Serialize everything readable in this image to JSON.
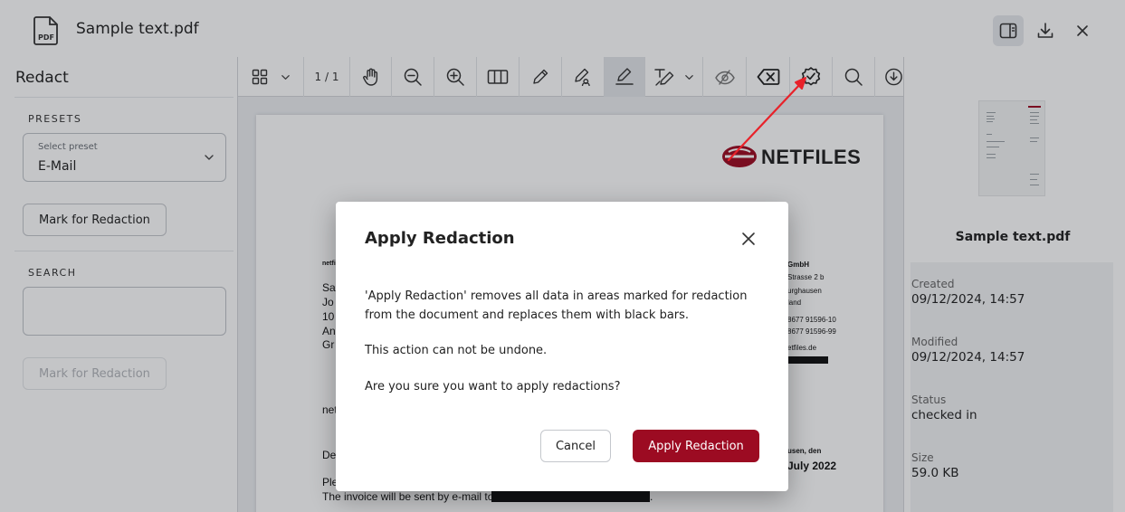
{
  "header": {
    "title": "Sample text.pdf",
    "file_icon_label": "PDF",
    "icons": [
      "pdf-file-icon",
      "sidebar-toggle-icon",
      "download-icon",
      "close-icon"
    ]
  },
  "left_panel": {
    "title": "Redact",
    "presets_label": "PRESETS",
    "select_caption": "Select preset",
    "select_value": "E-Mail",
    "mark_button": "Mark for Redaction",
    "search_label": "SEARCH",
    "search_value": "",
    "mark_button_search": "Mark for Redaction"
  },
  "toolbar": {
    "page_indicator": "1 / 1",
    "selected_tool": "redact-area",
    "icons": [
      "thumbnails-grid-icon",
      "chevron-down-icon",
      "hand-pan-icon",
      "zoom-out-icon",
      "zoom-in-icon",
      "two-page-view-icon",
      "pencil-icon",
      "sign-pen-icon",
      "redact-area-icon",
      "text-redact-icon",
      "chevron-down-icon",
      "hide-eye-icon",
      "clear-redaction-icon",
      "apply-redaction-badge-icon",
      "search-icon",
      "download-circle-icon"
    ]
  },
  "document": {
    "logo_text": "NETFILES",
    "left_fragments": [
      "netfi",
      "Sa",
      "Jo",
      "10",
      "An",
      "Gr",
      "net",
      "De",
      "Ple",
      "The invoice will be sent by e-mail to"
    ],
    "right_fragments": [
      "GmbH",
      "Strasse 2 b",
      "urghausen",
      "land",
      "8677 91596-10",
      "8677 91596-99",
      "etfiles.de",
      "usen, den",
      "July 2022"
    ],
    "trailing_text": "."
  },
  "right_panel": {
    "filename": "Sample text.pdf",
    "created_label": "Created",
    "created_value": "09/12/2024, 14:57",
    "modified_label": "Modified",
    "modified_value": "09/12/2024, 14:57",
    "status_label": "Status",
    "status_value": "checked in",
    "size_label": "Size",
    "size_value": "59.0 KB"
  },
  "modal": {
    "title": "Apply Redaction",
    "body_1": "'Apply Redaction' removes all data in areas marked for redaction from the document and replaces them with black bars.",
    "body_2": "This action can not be undone.",
    "body_3": "Are you sure you want to apply redactions?",
    "cancel_label": "Cancel",
    "apply_label": "Apply Redaction"
  },
  "colors": {
    "accent": "#9c0b22",
    "annotation_arrow": "#e8222a",
    "overlay": "rgba(20, 24, 32, 0.25)",
    "selected_tool_bg": "#e3e6ea"
  }
}
